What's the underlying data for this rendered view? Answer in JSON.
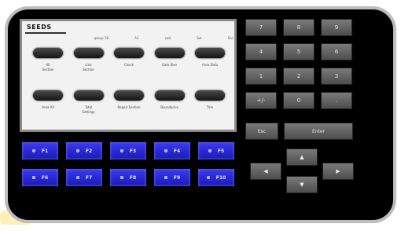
{
  "screen": {
    "title": "SEEDS",
    "header": [
      "group 78",
      "A1",
      "volt",
      "Set",
      "Sel"
    ],
    "row1": [
      {
        "label": "All\nSection"
      },
      {
        "label": "Line\nSection"
      },
      {
        "label": "Check"
      },
      {
        "label": "Gate Elev"
      },
      {
        "label": "Area Data"
      }
    ],
    "row2": [
      {
        "label": "Area All"
      },
      {
        "label": "Total\nSettings"
      },
      {
        "label": "Repair Section"
      },
      {
        "label": "Boundaries"
      },
      {
        "label": "Trim"
      }
    ]
  },
  "blue_buttons": [
    "F1",
    "F2",
    "F3",
    "F4",
    "F5",
    "F6",
    "F7",
    "F8",
    "F9",
    "F10"
  ],
  "keypad": [
    "7",
    "8",
    "9",
    "4",
    "5",
    "6",
    "1",
    "2",
    "3",
    "+/-",
    "0",
    "."
  ],
  "esc_label": "Esc",
  "enter_label": "Enter",
  "arrows": {
    "up": "▲",
    "left": "◀",
    "right": "▶",
    "down": "▼"
  }
}
